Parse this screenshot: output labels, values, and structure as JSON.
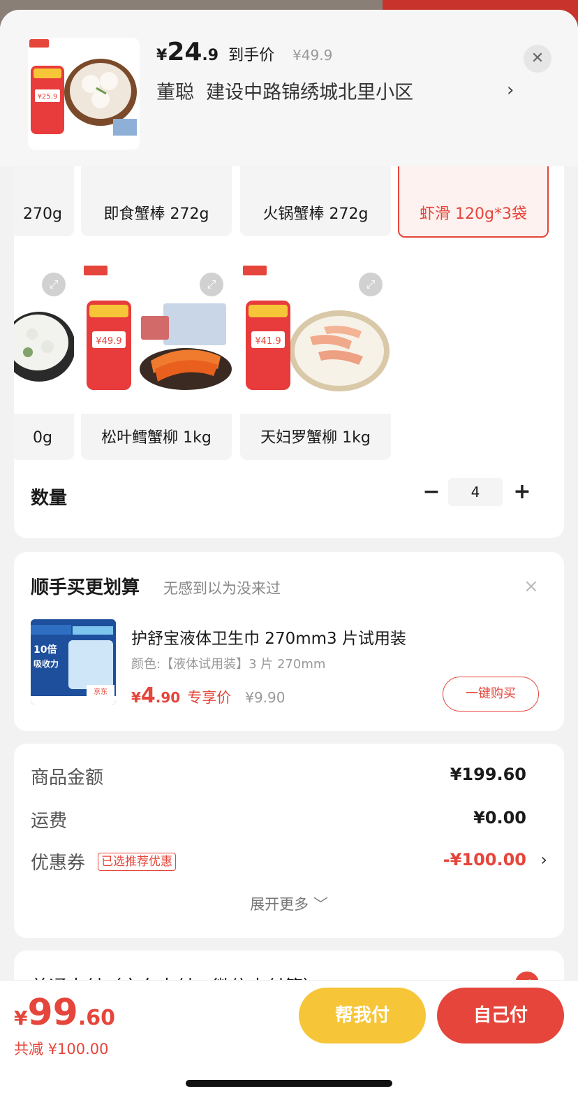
{
  "header": {
    "price_yen": "¥",
    "price_int": "24",
    "price_dec": ".9",
    "price_label": "到手价",
    "original_price": "¥49.9",
    "recipient": "董聪",
    "address": "建设中路锦绣城北里小区",
    "close_icon": "close-icon",
    "chevron_icon": "chevron-right-icon"
  },
  "variants": {
    "row1": [
      {
        "label": "270g",
        "selected": false
      },
      {
        "label": "即食蟹棒 272g",
        "selected": false
      },
      {
        "label": "火锅蟹棒 272g",
        "selected": false
      },
      {
        "label": "虾滑 120g*3袋",
        "selected": true
      }
    ],
    "row2": [
      {
        "label": "0g",
        "selected": false
      },
      {
        "label": "松叶鳕蟹柳 1kg",
        "selected": false
      },
      {
        "label": "天妇罗蟹柳 1kg",
        "selected": false
      }
    ],
    "expand_icon": "expand-icon",
    "colors": {
      "accent": "#e5453a",
      "selected_bg": "#fdf2f0"
    }
  },
  "quantity": {
    "label": "数量",
    "minus": "−",
    "value": "4",
    "plus": "+"
  },
  "recommend": {
    "title": "顺手买更划算",
    "subtitle": "无感到以为没来过",
    "close": "×",
    "product_name": "护舒宝液体卫生巾 270mm3 片试用装",
    "spec": "颜色:【液体试用装】3 片 270mm",
    "price_yen": "¥",
    "price_int": "4",
    "price_dec": ".90",
    "price_label": "专享价",
    "original_price": "¥9.90",
    "buy_label": "一键购买"
  },
  "summary": {
    "rows": [
      {
        "key": "商品金额",
        "value": "¥199.60"
      },
      {
        "key": "运费",
        "value": "¥0.00"
      },
      {
        "key": "优惠券",
        "value": "-¥100.00",
        "tag": "已选推荐优惠"
      }
    ],
    "more": "展开更多 ﹀"
  },
  "payment": {
    "label": "普通支付（京东支付、微信支付等）",
    "check": "✓"
  },
  "footer": {
    "total_yen": "¥",
    "total_int": "99",
    "total_dec": ".60",
    "saving": "共减 ¥100.00",
    "help_pay": "帮我付",
    "self_pay": "自己付",
    "colors": {
      "help": "#f6c638",
      "self": "#e5453a"
    }
  }
}
